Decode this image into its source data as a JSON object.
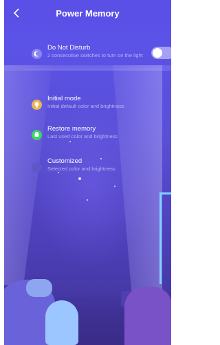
{
  "header": {
    "back_icon": "chevron-left-icon",
    "title": "Power Memory"
  },
  "do_not_disturb": {
    "icon": "moon-icon",
    "label": "Do Not Disturb",
    "description": "2 consecutive switches to turn on the light",
    "enabled": false
  },
  "modes": [
    {
      "icon": "bulb-icon",
      "icon_color": "#e8b552",
      "label": "Initial mode",
      "description": "Initial default color and brightness"
    },
    {
      "icon": "restore-icon",
      "icon_color": "#3ed46a",
      "label": "Restore memory",
      "description": "Last used color and brightness"
    },
    {
      "icon": "customize-icon",
      "icon_color": "#5e57c8",
      "label": "Customized",
      "description": "Selected color and brightness"
    }
  ],
  "colors": {
    "accent": "#5b52e8",
    "toggle_off": "#b9b4ef"
  }
}
